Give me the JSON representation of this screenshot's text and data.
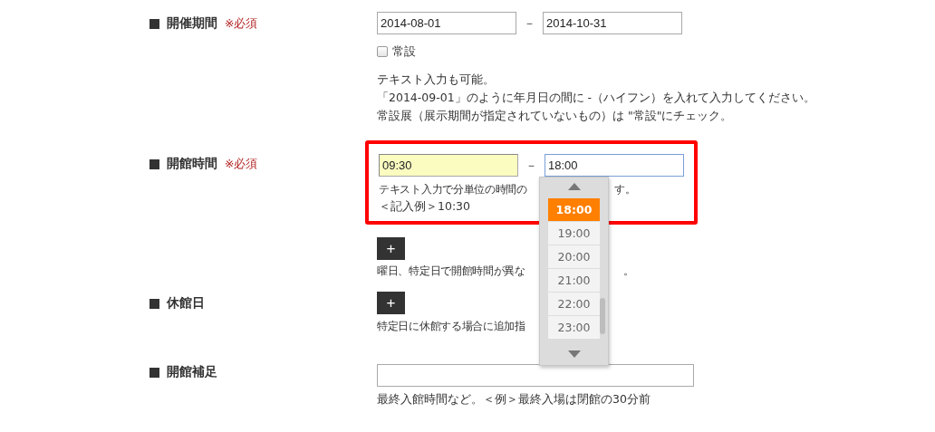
{
  "period": {
    "label": "開催期間",
    "required": "※必須",
    "start": "2014-08-01",
    "separator": "－",
    "end": "2014-10-31",
    "permanent": {
      "label": "常設",
      "checked": false
    },
    "notes": [
      "テキスト入力も可能。",
      "「2014-09-01」のように年月日の間に -（ハイフン）を入れて入力してください。",
      "常設展（展示期間が指定されていないもの）は \"常設\"にチェック。"
    ]
  },
  "hours": {
    "label": "開館時間",
    "required": "※必須",
    "highlighted": true,
    "open": {
      "value": "09:30",
      "autofill": true,
      "focused": false
    },
    "separator": "－",
    "close": {
      "value": "18:00",
      "autofill": false,
      "focused": true
    },
    "dropdown": {
      "open": true,
      "options": [
        {
          "label": "18:00",
          "selected": true
        },
        {
          "label": "19:00",
          "selected": false
        },
        {
          "label": "20:00",
          "selected": false
        },
        {
          "label": "21:00",
          "selected": false
        },
        {
          "label": "22:00",
          "selected": false
        },
        {
          "label": "23:00",
          "selected": false
        }
      ]
    },
    "hint": [
      "テキスト入力で分単位の時間の",
      "す。"
    ],
    "example": "＜記入例＞10:30",
    "add_button": "+",
    "add_note": [
      "曜日、特定日で開館時間が異な",
      "。"
    ]
  },
  "closed": {
    "label": "休館日",
    "add_button": "+",
    "add_note": [
      "特定日に休館する場合に追加指"
    ]
  },
  "extra": {
    "label": "開館補足",
    "hint": "最終入館時間など。＜例＞最終入場は閉館の30分前"
  }
}
